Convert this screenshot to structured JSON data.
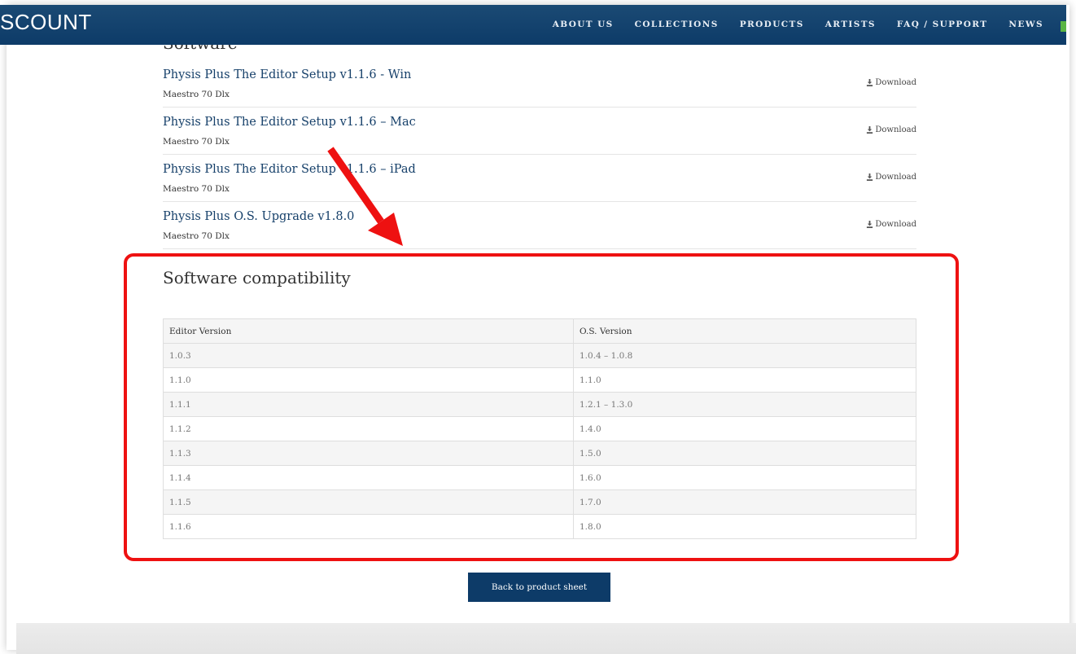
{
  "header": {
    "logo": "SCOUNT",
    "nav": [
      "ABOUT US",
      "COLLECTIONS",
      "PRODUCTS",
      "ARTISTS",
      "FAQ / SUPPORT",
      "NEWS"
    ]
  },
  "software_heading_partial": "Software",
  "downloads": [
    {
      "title": "Physis Plus The Editor Setup v1.1.6 - Win",
      "product": "Maestro 70 Dlx",
      "link": "Download"
    },
    {
      "title": "Physis Plus The Editor Setup v1.1.6 – Mac",
      "product": "Maestro 70 Dlx",
      "link": "Download"
    },
    {
      "title": "Physis Plus The Editor Setup v1.1.6 – iPad",
      "product": "Maestro 70 Dlx",
      "link": "Download"
    },
    {
      "title": "Physis Plus O.S. Upgrade v1.8.0",
      "product": "Maestro 70 Dlx",
      "link": "Download"
    }
  ],
  "compatibility": {
    "title": "Software compatibility",
    "headers": [
      "Editor Version",
      "O.S. Version"
    ],
    "rows": [
      [
        "1.0.3",
        "1.0.4 – 1.0.8"
      ],
      [
        "1.1.0",
        "1.1.0"
      ],
      [
        "1.1.1",
        "1.2.1 – 1.3.0"
      ],
      [
        "1.1.2",
        "1.4.0"
      ],
      [
        "1.1.3",
        "1.5.0"
      ],
      [
        "1.1.4",
        "1.6.0"
      ],
      [
        "1.1.5",
        "1.7.0"
      ],
      [
        "1.1.6",
        "1.8.0"
      ]
    ]
  },
  "back_button": "Back to product sheet",
  "colors": {
    "navy": "#0d3b68",
    "link": "#16406a",
    "annotation_red": "#ee1111",
    "accent_green": "#5ab545"
  },
  "icons": {
    "download": "download-icon"
  }
}
